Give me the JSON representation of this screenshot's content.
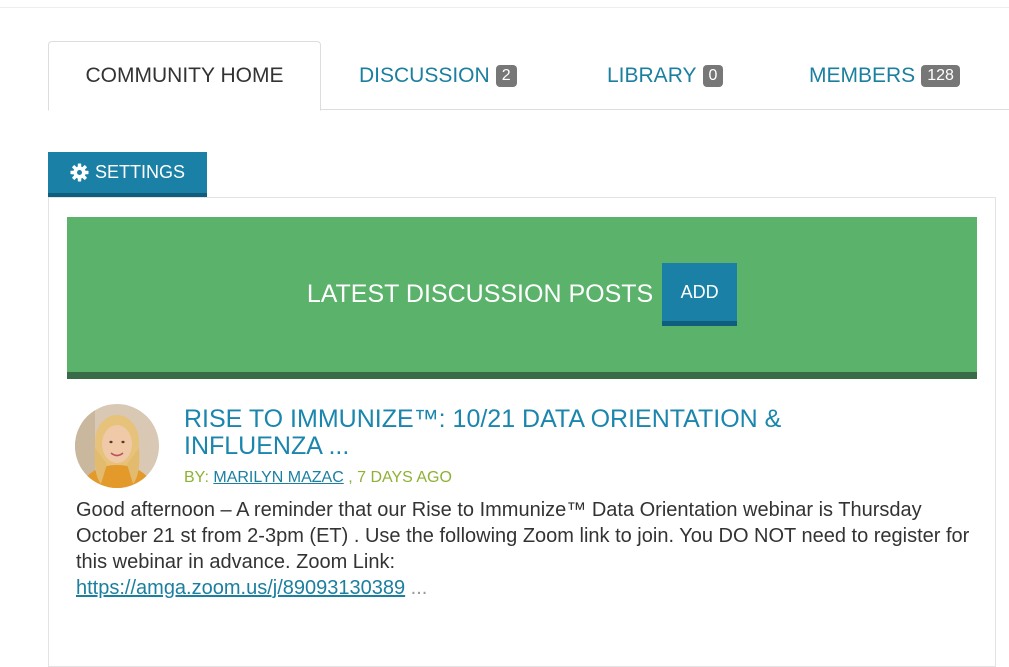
{
  "tabs": [
    {
      "label": "COMMUNITY HOME",
      "active": true
    },
    {
      "label": "DISCUSSION",
      "count": "2"
    },
    {
      "label": "LIBRARY",
      "count": "0"
    },
    {
      "label": "MEMBERS",
      "count": "128"
    }
  ],
  "settings": {
    "label": "SETTINGS",
    "icon": "gear-icon"
  },
  "banner": {
    "title": "LATEST DISCUSSION POSTS",
    "add_label": "ADD"
  },
  "post": {
    "title_line1": "RISE TO IMMUNIZE™: 10/21 DATA ORIENTATION &",
    "title_line2": "INFLUENZA ...",
    "by_prefix": "BY:",
    "author": "MARILYN MAZAC",
    "time": ", 7 DAYS AGO",
    "body": "Good afternoon – A reminder that our Rise to Immunize™ Data Orientation webinar is Thursday October 21 st from 2-3pm (ET) . Use the following Zoom link to join. You DO NOT need to register for this webinar in advance. Zoom Link:",
    "link": "https://amga.zoom.us/j/89093130389",
    "ellipsis": " ..."
  },
  "colors": {
    "accent": "#1a80a6",
    "banner_green": "#5ab26b",
    "banner_border": "#3a6b49",
    "link": "#1b7fa0",
    "meta_green": "#8fb135",
    "badge_gray": "#777777"
  }
}
